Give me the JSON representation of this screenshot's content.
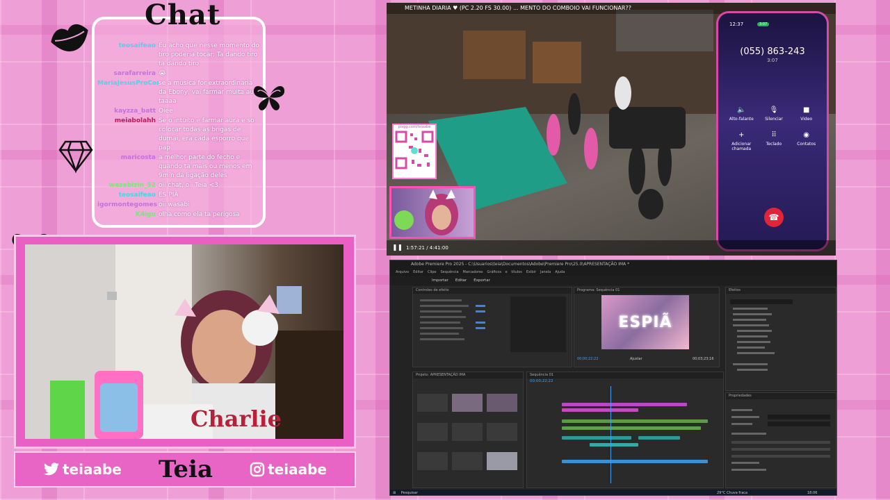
{
  "chat": {
    "title": "Chat",
    "messages": [
      {
        "user": "teosaifeao",
        "text": "Eu acho que nesse momento do tiro poderia tocar: Ta dando tiro ta dando tiro",
        "color": "#4fd2e8"
      },
      {
        "user": "sarafarreira",
        "text": "😭",
        "color": "#c56fe0"
      },
      {
        "user": "MariaJesusProCorrgr",
        "text": "se a musica for extraordinaria da Ebony, vai farmar muita aura taaaa",
        "color": "#4fd2e8"
      },
      {
        "user": "kayzza_batt",
        "text": "Oiee",
        "color": "#c56fe0"
      },
      {
        "user": "meiabolahh",
        "text": "Se o intuito e farmar aura e so colocar todas as brigas de dumai, era cada esporro que pap",
        "color": "#c2185b"
      },
      {
        "user": "maricosta",
        "text": "a melhor parte do fecho e quando ta mais ou menos em 9min da ligação deles",
        "color": "#c56fe0"
      },
      {
        "user": "wasabizin_52",
        "text": "oii chat, oii Teia <3",
        "color": "#7ee37a"
      },
      {
        "user": "teosaifeao",
        "text": "ES PIÃ",
        "color": "#4fd2e8"
      },
      {
        "user": "igormontegomes",
        "text": "oii wasabi",
        "color": "#c56fe0"
      },
      {
        "user": "K4igu",
        "text": "olha como ela ta perigosa",
        "color": "#7ee37a"
      }
    ]
  },
  "stream": {
    "twitter_handle": "teiaabe",
    "brand_name": "Teia",
    "instagram_handle": "teiaabe"
  },
  "game": {
    "title_bar": "METINHA DIARIA ♥ (PC 2.20 FS 30.00) ... MENTO DO COMBOIO VAI FUNCIONAR??",
    "qr_label": "pixgg.com/teiaabe",
    "playback_time": "1:57:21 / 4:41:00",
    "phone": {
      "time": "12:37",
      "badge": "3:07",
      "number": "(055) 863-243",
      "duration": "3:07",
      "buttons": [
        {
          "label": "Alto-falante",
          "icon": "speaker-icon"
        },
        {
          "label": "Silenciar",
          "icon": "mic-icon"
        },
        {
          "label": "Video",
          "icon": "camera-icon"
        },
        {
          "label": "Adicionar chamada",
          "icon": "plus-icon"
        },
        {
          "label": "Teclado",
          "icon": "keypad-icon"
        },
        {
          "label": "Contatos",
          "icon": "contact-icon"
        }
      ]
    }
  },
  "premiere": {
    "window_title": "Adobe Premiere Pro 2025 - C:\\Usuarios\\teia\\Documentos\\Adobe\\Premiere Pro\\25.0\\APRESENTAÇÃO IMA *",
    "menu": [
      "Arquivo",
      "Editar",
      "Clipe",
      "Sequência",
      "Marcadores",
      "Gráficos e títulos",
      "Exibir",
      "Janela",
      "Ajuda"
    ],
    "tabs": [
      "Importar",
      "Editar",
      "Exportar"
    ],
    "program_label": "Programa: Sequência 01",
    "preview_text": "ESPIÃ",
    "timecode_left": "00;00;22;22",
    "timecode_right": "00;03;23;16",
    "zoom": "Ajustar",
    "project_label": "Projeto: APRESENTAÇÃO IMA",
    "sequence_label": "Sequência 01",
    "timeline_timecode": "00;00;22;22",
    "search_placeholder": "Pesquisar",
    "weather": "29°C Chuva fraca",
    "clock": "18:06"
  }
}
